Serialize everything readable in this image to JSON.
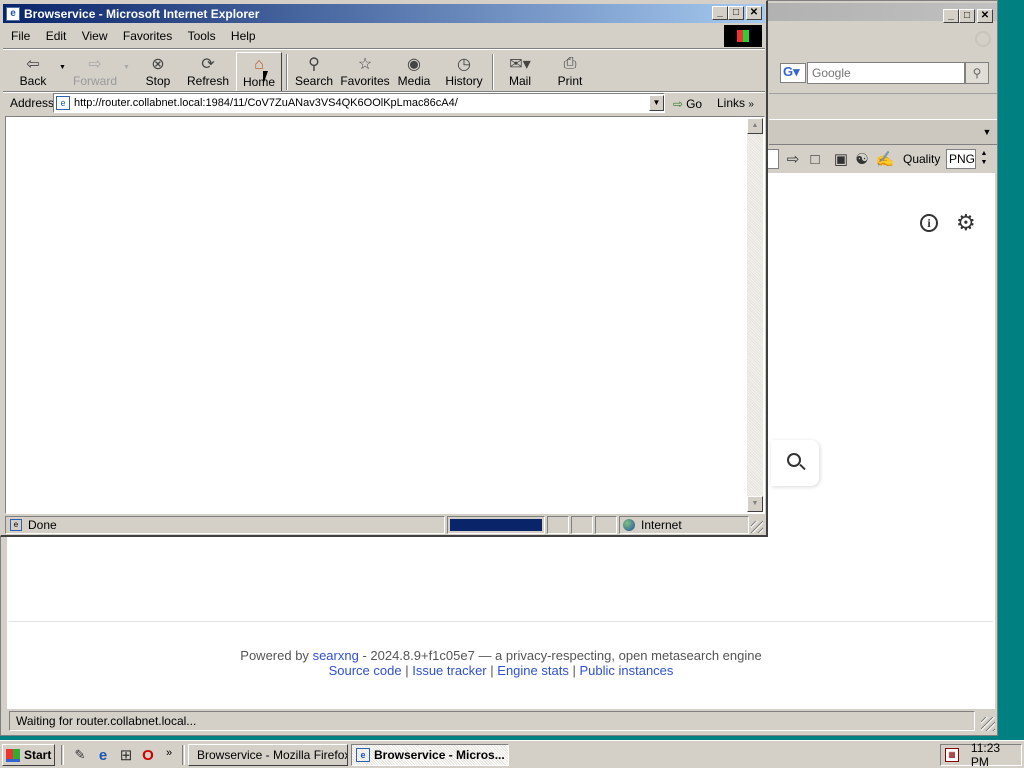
{
  "ff": {
    "search_placeholder": "Google",
    "quality_label": "Quality",
    "quality_value": "PNG",
    "footer": {
      "powered_by": "Powered by",
      "searxng": "searxng",
      "version_text": "- 2024.8.9+f1c05e7 — a privacy-respecting, open metasearch engine",
      "source_code": "Source code",
      "issue_tracker": "Issue tracker",
      "engine_stats": "Engine stats",
      "public_instances": "Public instances",
      "sep": "|"
    },
    "status_text": "Waiting for router.collabnet.local..."
  },
  "ie": {
    "title": "Browservice - Microsoft Internet Explorer",
    "menu": [
      "File",
      "Edit",
      "View",
      "Favorites",
      "Tools",
      "Help"
    ],
    "toolbar": {
      "back": "Back",
      "forward": "Forward",
      "stop": "Stop",
      "refresh": "Refresh",
      "home": "Home",
      "search": "Search",
      "favorites": "Favorites",
      "media": "Media",
      "history": "History",
      "mail": "Mail",
      "print": "Print"
    },
    "address_label": "Address",
    "address_value": "http://router.collabnet.local:1984/11/CoV7ZuANav3VS4QK6OOlKpLmac86cA4/",
    "go_label": "Go",
    "links_label": "Links",
    "status_text": "Done",
    "progress": 1.0,
    "zone_label": "Internet"
  },
  "taskbar": {
    "start_label": "Start",
    "tasks": [
      "Browservice - Mozilla Firefox",
      "Browservice - Micros..."
    ],
    "clock": "11:23 PM"
  },
  "colors": {
    "title_active": "#0a246a",
    "progress": "#0a246a",
    "desktop": "#008080",
    "link": "#3050d0"
  }
}
